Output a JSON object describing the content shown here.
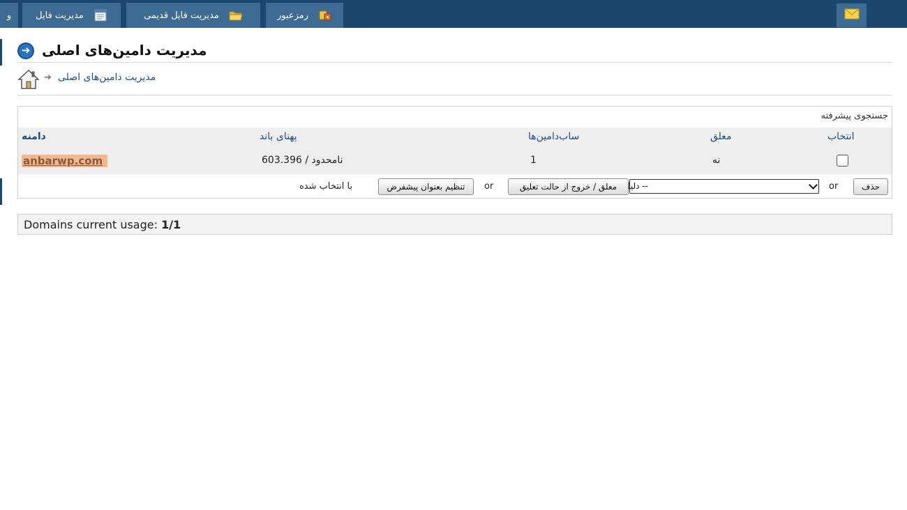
{
  "topbar": {
    "tabs": [
      {
        "label": "و"
      },
      {
        "label": "مدیریت فایل"
      },
      {
        "label": "مدیریت فایل قدیمی"
      },
      {
        "label": "رمزعبور"
      }
    ]
  },
  "header": {
    "title": "مدیریت دامین‌های اصلی",
    "breadcrumb": "مدیریت دامین‌های اصلی"
  },
  "table": {
    "advanced_search": "جستجوی پیشرفته",
    "columns": {
      "select": "انتخاب",
      "suspended": "معلق",
      "subdomains": "ساب‌دامین‌ها",
      "bandwidth": "پهنای باند",
      "domain": "دامنه"
    },
    "rows": [
      {
        "suspended": "نه",
        "subdomains": "1",
        "bandwidth": "نامحدود / 603.396",
        "domain": "anbarwp.com"
      }
    ],
    "actions": {
      "delete": "حذف",
      "or": "or",
      "reason_select": "-- دلیل:",
      "suspend": "معلق / خروج از حالت تعلیق",
      "set_default": "تنظیم بعنوان پیشفرض",
      "with_selected": "با انتخاب شده"
    }
  },
  "usage": {
    "label": "Domains current usage:",
    "value": "1/1"
  },
  "icons": [
    "password-icon",
    "folder-icon",
    "file-manager-icon",
    "mail-icon",
    "arrow-right-icon",
    "home-icon"
  ],
  "colors": {
    "topbar": "#1c466e",
    "tab": "#3e6b94",
    "link": "#1d4f86",
    "highlight": "#f6b78f"
  }
}
